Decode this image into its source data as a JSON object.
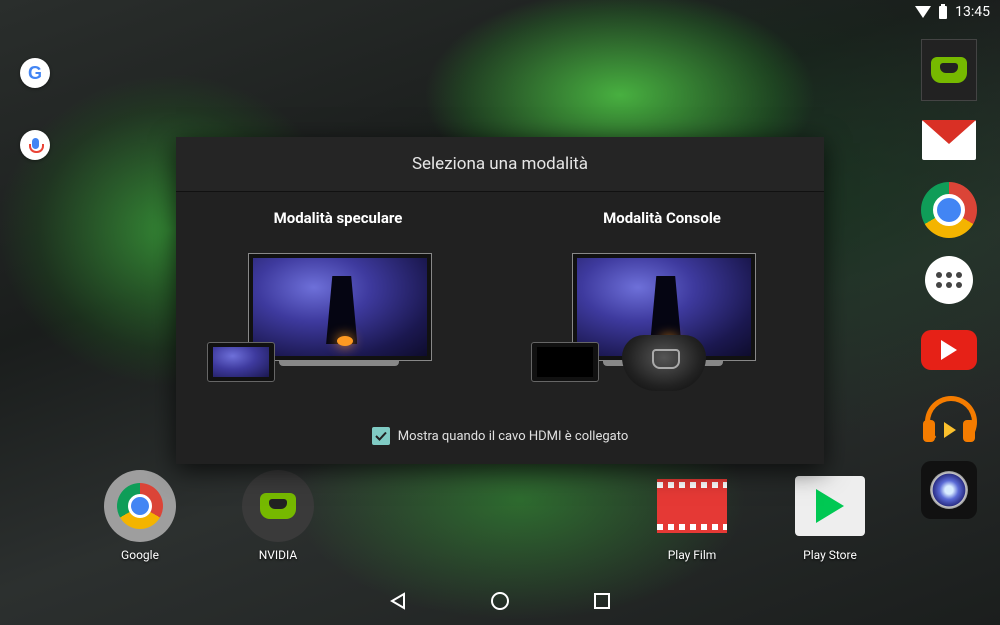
{
  "status_bar": {
    "time": "13:45"
  },
  "dialog": {
    "title": "Seleziona una modalità",
    "modes": [
      {
        "label": "Modalità speculare"
      },
      {
        "label": "Modalità Console"
      }
    ],
    "checkbox": {
      "label": "Mostra quando il cavo HDMI è collegato",
      "checked": true
    }
  },
  "desktop_apps": [
    {
      "label": "Google",
      "icon": "chrome-folder-icon"
    },
    {
      "label": "NVIDIA",
      "icon": "nvidia-shield-icon"
    },
    {
      "label": "Play Film",
      "icon": "play-movies-icon"
    },
    {
      "label": "Play Store",
      "icon": "play-store-icon"
    }
  ],
  "dock_right": [
    "nvidia-shield-hub-icon",
    "gmail-icon",
    "chrome-icon",
    "app-drawer-icon",
    "youtube-icon",
    "play-music-icon",
    "camera-icon"
  ],
  "nav_bar": [
    "back",
    "home",
    "recents"
  ]
}
